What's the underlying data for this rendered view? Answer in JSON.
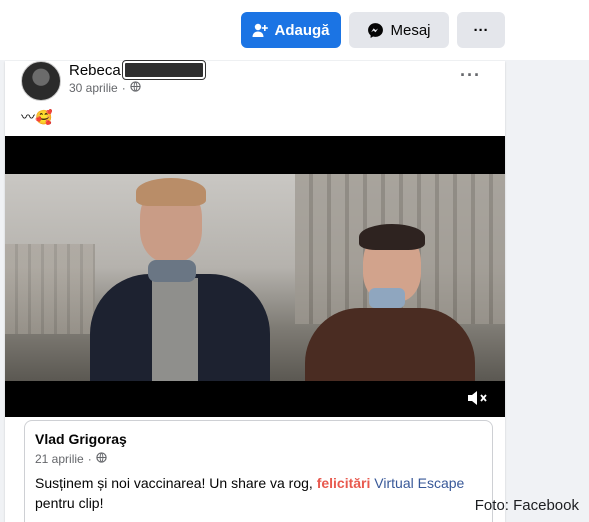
{
  "actions": {
    "add_label": "Adaugă",
    "message_label": "Mesaj",
    "more_label": "···"
  },
  "post": {
    "author": "Rebeca",
    "date": "30 aprilie",
    "more": "···",
    "emoji_text": "〰🥰"
  },
  "shared_post": {
    "author": "Vlad Grigoraş",
    "date": "21 aprilie",
    "text_part1": "Susținem și noi vaccinarea! Un share va rog, ",
    "text_highlight1": "felicitări",
    "text_part2": " ",
    "text_highlight2": "Virtual Escape",
    "text_part3": " pentru clip!"
  },
  "credit": "Foto: Facebook",
  "colors": {
    "primary": "#1b74e4",
    "secondary_button": "#e4e6eb",
    "background": "#f0f2f5",
    "muted_text": "#65676b",
    "highlight_red": "#e85a4f",
    "highlight_blue": "#385898"
  },
  "icons": {
    "add": "add-friend-icon",
    "message": "messenger-icon",
    "globe": "globe-icon",
    "mute": "mute-icon"
  }
}
